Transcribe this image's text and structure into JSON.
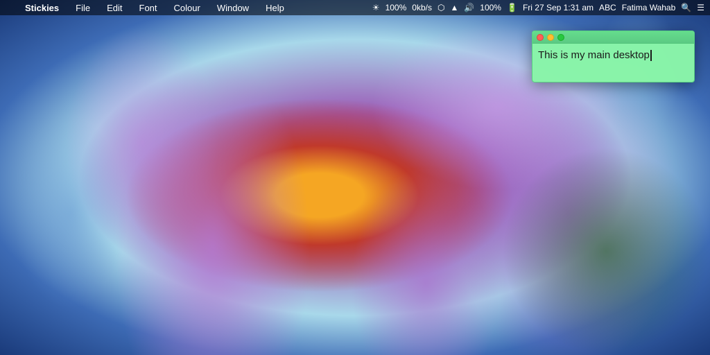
{
  "desktop": {
    "bg_description": "Purple aster flower macro photography"
  },
  "menubar": {
    "apple_symbol": "",
    "app_name": "Stickies",
    "menus": [
      "File",
      "Edit",
      "Font",
      "Colour",
      "Window",
      "Help"
    ],
    "status_right": {
      "brightness_icon": "☀",
      "brightness": "100%",
      "network_up": "0kb/s",
      "battery_percent": "100%",
      "datetime": "Fri 27 Sep  1:31 am",
      "keyboard": "ABC",
      "user": "Fatima Wahab"
    }
  },
  "sticky_note": {
    "content": "This is my main desktop",
    "traffic_lights": {
      "close_label": "close",
      "minimize_label": "minimize",
      "maximize_label": "maximize"
    }
  }
}
